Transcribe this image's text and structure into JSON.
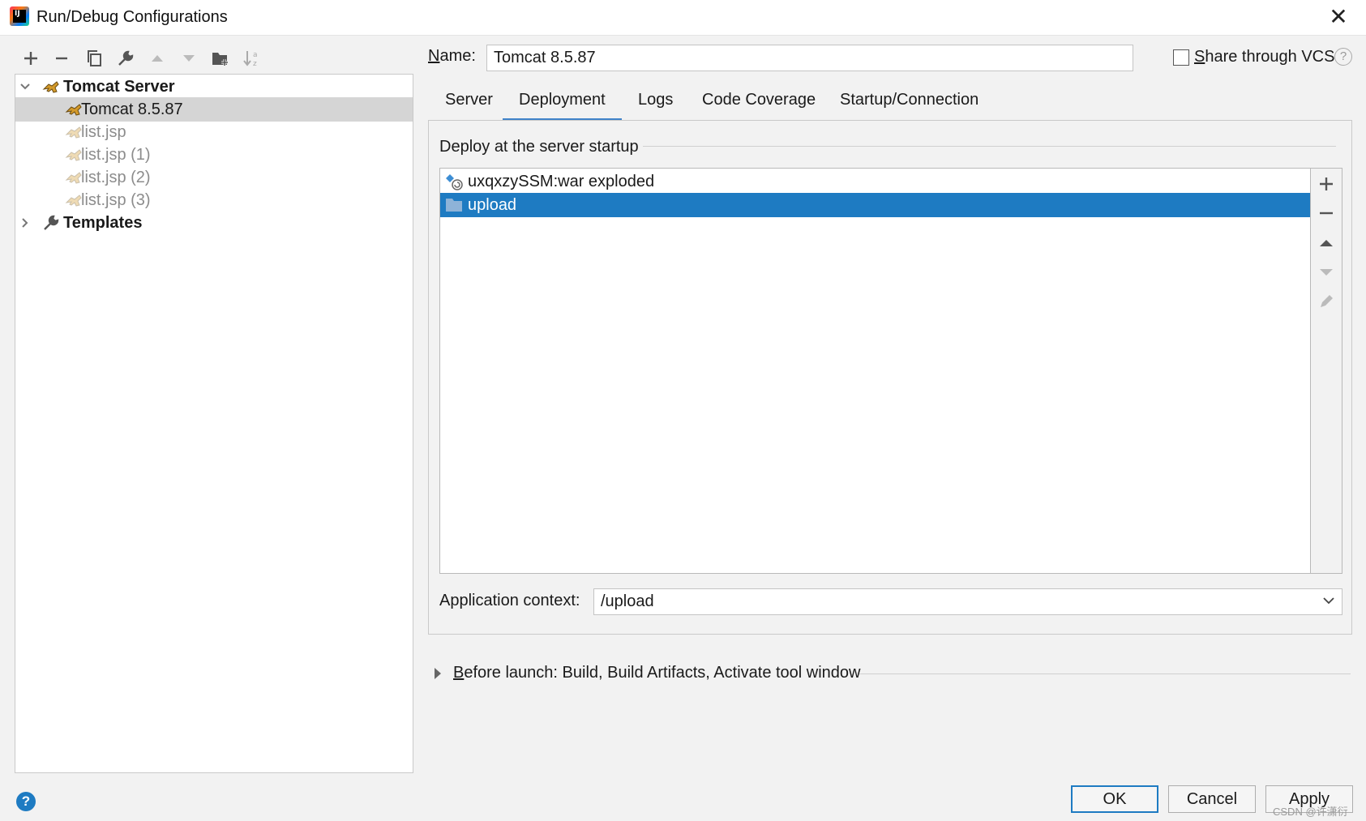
{
  "window": {
    "title": "Run/Debug Configurations",
    "close_glyph": "✕"
  },
  "toolbar": {
    "items": [
      {
        "name": "add-icon",
        "glyph": "+"
      },
      {
        "name": "remove-icon",
        "glyph": "−"
      },
      {
        "name": "copy-icon",
        "glyph": "⧉"
      },
      {
        "name": "wrench-icon",
        "glyph": "🔧"
      },
      {
        "name": "move-up-icon",
        "glyph": "▲"
      },
      {
        "name": "move-down-icon",
        "glyph": "▼"
      },
      {
        "name": "new-folder-icon",
        "glyph": "📁"
      },
      {
        "name": "sort-icon",
        "glyph": "⇅"
      }
    ]
  },
  "tree": {
    "group": {
      "label": "Tomcat Server",
      "expanded": true
    },
    "items": [
      {
        "label": "Tomcat 8.5.87",
        "selected": true,
        "temporary": false
      },
      {
        "label": "list.jsp",
        "selected": false,
        "temporary": true
      },
      {
        "label": "list.jsp (1)",
        "selected": false,
        "temporary": true
      },
      {
        "label": "list.jsp (2)",
        "selected": false,
        "temporary": true
      },
      {
        "label": "list.jsp (3)",
        "selected": false,
        "temporary": true
      }
    ],
    "templates": {
      "label": "Templates",
      "expanded": false
    }
  },
  "name_field": {
    "label_mnemonic": "N",
    "label_rest": "ame:",
    "value": "Tomcat 8.5.87"
  },
  "share": {
    "checked": false,
    "label_mnemonic": "S",
    "label_rest": "hare through VCS",
    "help_glyph": "?"
  },
  "tabs": [
    {
      "label": "Server",
      "active": false
    },
    {
      "label": "Deployment",
      "active": true
    },
    {
      "label": "Logs",
      "active": false
    },
    {
      "label": "Code Coverage",
      "active": false
    },
    {
      "label": "Startup/Connection",
      "active": false
    }
  ],
  "deployment": {
    "group_title": "Deploy at the server startup",
    "items": [
      {
        "label": "uxqxzySSM:war exploded",
        "icon": "artifact-exploded-icon",
        "selected": false
      },
      {
        "label": "upload",
        "icon": "folder-icon",
        "selected": true
      }
    ],
    "side_tools": [
      {
        "name": "add-deployment-icon",
        "glyph": "+",
        "enabled": true
      },
      {
        "name": "remove-deployment-icon",
        "glyph": "−",
        "enabled": true
      },
      {
        "name": "move-up-deployment-icon",
        "glyph": "▲",
        "enabled": true
      },
      {
        "name": "move-down-deployment-icon",
        "glyph": "▼",
        "enabled": false
      },
      {
        "name": "edit-deployment-icon",
        "glyph": "✎",
        "enabled": false
      }
    ],
    "context_label": "Application context:",
    "context_value": "/upload",
    "chevron_glyph": "⌵"
  },
  "before_launch": {
    "mnemonic": "B",
    "rest": "efore launch: Build, Build Artifacts, Activate tool window"
  },
  "footer": {
    "help_glyph": "?",
    "ok_label": "OK",
    "cancel_label": "Cancel",
    "apply_label": "Apply",
    "watermark": "CSDN @许潇衍"
  },
  "colors": {
    "selection_blue": "#1e7bc2",
    "tab_underline": "#4083c9",
    "tree_selection": "#d5d5d5",
    "background": "#f2f2f2"
  }
}
